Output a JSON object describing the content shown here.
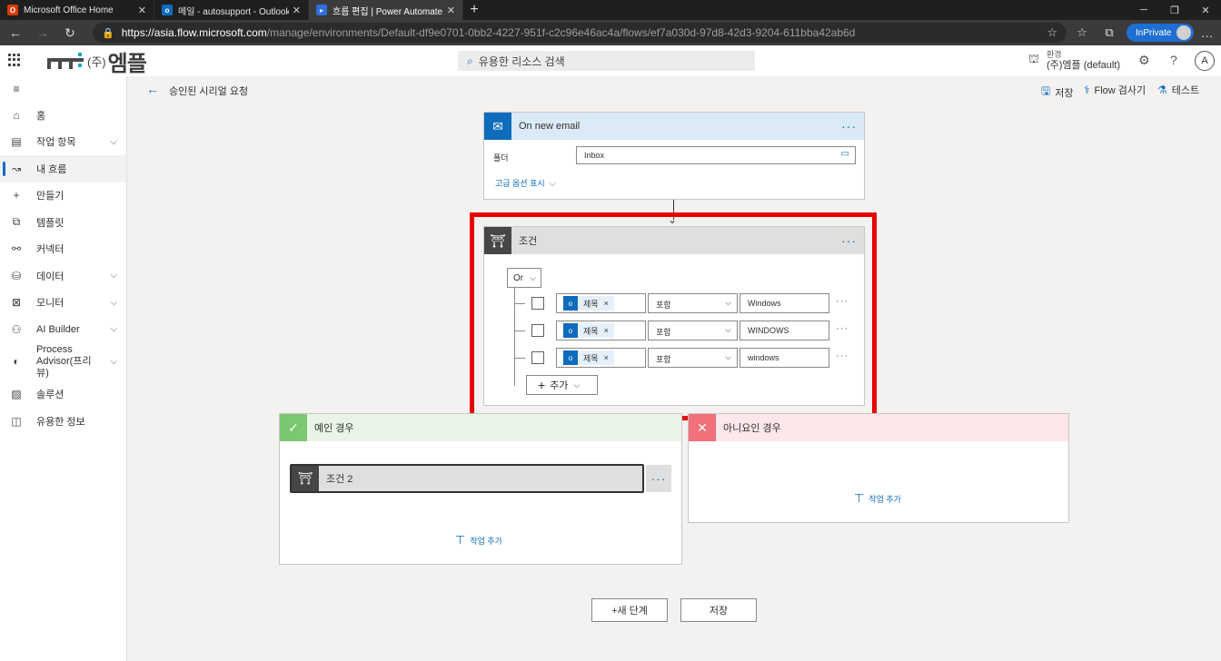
{
  "browser": {
    "tabs": [
      {
        "title": "Microsoft Office Home",
        "active": false,
        "favicon": "office-icon",
        "color": "#d83b01"
      },
      {
        "title": "메일 - autosupport - Outlook",
        "active": false,
        "favicon": "outlook-icon",
        "color": "#0f6cbd"
      },
      {
        "title": "흐름 편집 | Power Automate",
        "active": true,
        "favicon": "power-automate-icon",
        "color": "#2f6fde"
      }
    ],
    "url_host": "https://asia.flow.microsoft.com",
    "url_path": "/manage/environments/Default-df9e0701-0bb2-4227-951f-c2c96e46ac4a/flows/ef7a030d-97d8-42d3-9204-611bba42ab6d",
    "inprivate_label": "InPrivate"
  },
  "header": {
    "logo_sub": "(주)",
    "logo_name": "엠플",
    "search_placeholder": "유용한 리소스 검색",
    "env_label": "환경",
    "env_name": "(주)엠플 (default)",
    "avatar_initial": "A"
  },
  "nav": {
    "items": [
      {
        "label": "홈",
        "icon": "home-icon",
        "chevron": false
      },
      {
        "label": "작업 항목",
        "icon": "clipboard-icon",
        "chevron": true
      },
      {
        "label": "내 흐름",
        "icon": "flow-icon",
        "chevron": false,
        "selected": true
      },
      {
        "label": "만들기",
        "icon": "plus-icon",
        "chevron": false
      },
      {
        "label": "템플릿",
        "icon": "template-icon",
        "chevron": false
      },
      {
        "label": "커넥터",
        "icon": "connector-icon",
        "chevron": false
      },
      {
        "label": "데이터",
        "icon": "database-icon",
        "chevron": true
      },
      {
        "label": "모니터",
        "icon": "monitor-icon",
        "chevron": true
      },
      {
        "label": "AI Builder",
        "icon": "ai-builder-icon",
        "chevron": true
      },
      {
        "label": "Process Advisor(프리뷰)",
        "icon": "process-advisor-icon",
        "chevron": true
      },
      {
        "label": "솔루션",
        "icon": "solution-icon",
        "chevron": false
      },
      {
        "label": "유용한 정보",
        "icon": "book-icon",
        "chevron": false
      }
    ]
  },
  "cmdbar": {
    "flow_name": "승인된 시리얼 요청",
    "save": "저장",
    "checker": "Flow 검사기",
    "test": "테스트"
  },
  "trigger": {
    "title": "On new email",
    "folder_label": "폴더",
    "folder_value": "Inbox",
    "advanced_link": "고급 옵션 표시"
  },
  "condition": {
    "title": "조건",
    "group_operator": "Or",
    "rows": [
      {
        "token": "제목",
        "operator": "포함",
        "value": "Windows"
      },
      {
        "token": "제목",
        "operator": "포함",
        "value": "WINDOWS"
      },
      {
        "token": "제목",
        "operator": "포함",
        "value": "windows"
      }
    ],
    "add_button": "추가",
    "highlight_color": "#e80000"
  },
  "branches": {
    "yes_title": "예인 경우",
    "yes_inner_title": "조건 2",
    "no_title": "아니요인 경우",
    "add_action": "작업 추가"
  },
  "footer": {
    "new_step": "+새 단계",
    "save": "저장"
  }
}
